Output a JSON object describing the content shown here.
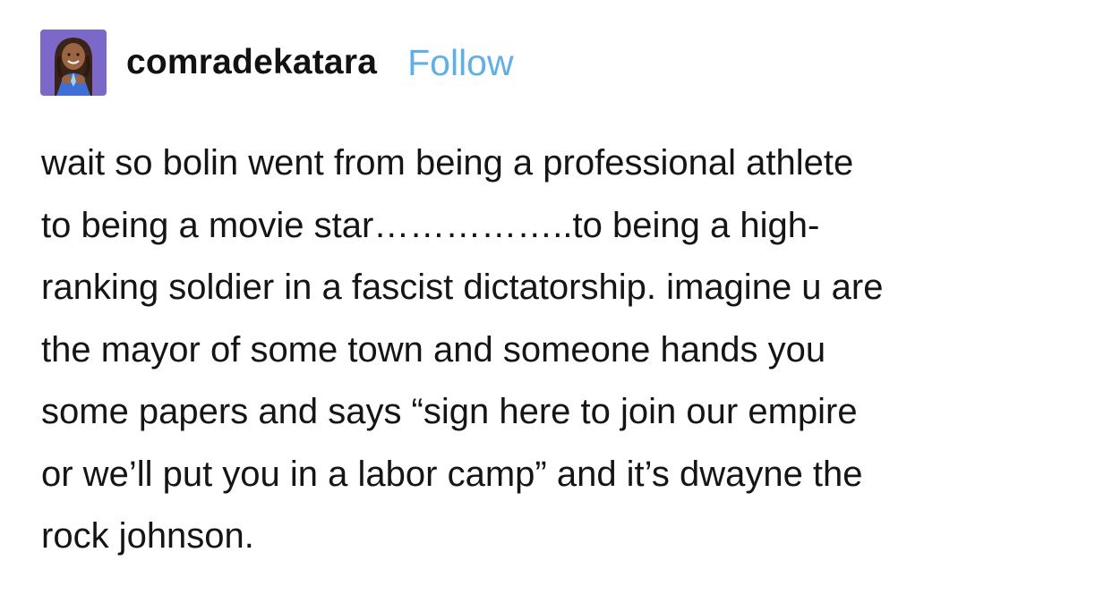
{
  "post": {
    "author": "comradekatara",
    "follow_label": "Follow",
    "avatar_icon": "user-avatar-icon",
    "follow_color": "#5fb0e8",
    "body_lines": [
      "wait so bolin went from being a professional athlete",
      "to being a movie star……………..to being a high-",
      "ranking soldier in a fascist dictatorship. imagine u are",
      "the mayor of some town and someone hands you",
      "some papers and says “sign here to join our empire",
      "or we’ll put you in a labor camp” and it’s dwayne the",
      "rock johnson."
    ]
  }
}
